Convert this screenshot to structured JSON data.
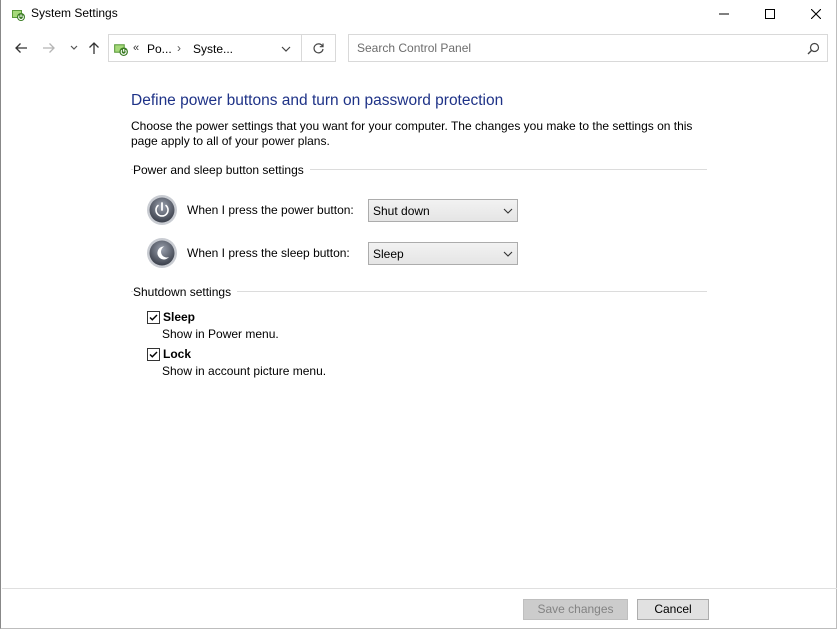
{
  "window": {
    "title": "System Settings",
    "icons": {
      "app": "power-options-icon",
      "minimize": "minimize-icon",
      "maximize": "maximize-icon",
      "close": "close-icon"
    }
  },
  "nav": {
    "icons": {
      "back": "back-arrow-icon",
      "forward": "forward-arrow-icon",
      "recent": "chevron-down-icon",
      "up": "up-arrow-icon",
      "refresh": "refresh-icon",
      "search": "search-icon"
    },
    "address": {
      "overflow": "«",
      "segments": [
        "Po...",
        "Syste..."
      ],
      "separator": "›"
    },
    "search_placeholder": "Search Control Panel"
  },
  "main": {
    "heading": "Define power buttons and turn on password protection",
    "description": "Choose the power settings that you want for your computer. The changes you make to the settings on this page apply to all of your power plans.",
    "power_group": {
      "label": "Power and sleep button settings",
      "rows": [
        {
          "label": "When I press the power button:",
          "value": "Shut down",
          "icon": "power-button-icon"
        },
        {
          "label": "When I press the sleep button:",
          "value": "Sleep",
          "icon": "sleep-button-icon"
        }
      ]
    },
    "shutdown_group": {
      "label": "Shutdown settings",
      "items": [
        {
          "title": "Sleep",
          "subtitle": "Show in Power menu.",
          "checked": true
        },
        {
          "title": "Lock",
          "subtitle": "Show in account picture menu.",
          "checked": true
        }
      ]
    }
  },
  "footer": {
    "save_label": "Save changes",
    "cancel_label": "Cancel",
    "save_enabled": false
  },
  "colors": {
    "heading": "#1e3287",
    "disabled_button_bg": "#cccccc",
    "disabled_text": "#838383"
  }
}
